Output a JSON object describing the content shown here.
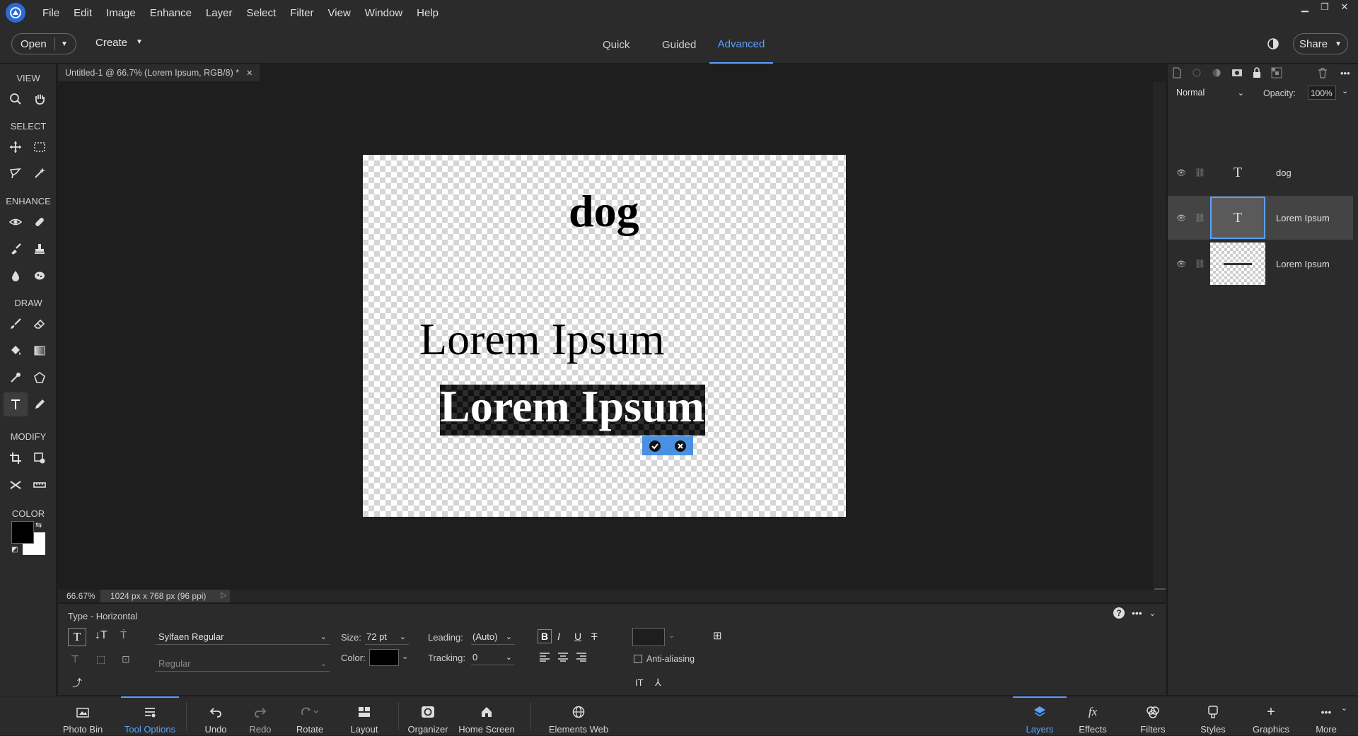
{
  "menubar": {
    "items": [
      "File",
      "Edit",
      "Image",
      "Enhance",
      "Layer",
      "Select",
      "Filter",
      "View",
      "Window",
      "Help"
    ]
  },
  "topbar": {
    "open_label": "Open",
    "create_label": "Create",
    "modes": [
      "Quick",
      "Guided",
      "Advanced"
    ],
    "active_mode": "Advanced",
    "share_label": "Share"
  },
  "toolbar": {
    "sections": [
      "VIEW",
      "SELECT",
      "ENHANCE",
      "DRAW",
      "MODIFY",
      "COLOR"
    ]
  },
  "document": {
    "tab_title": "Untitled-1 @ 66.7% (Lorem Ipsum, RGB/8) *",
    "zoom": "66.67%",
    "dimensions": "1024 px x 768 px (96 ppi)"
  },
  "canvas": {
    "text_dog": "dog",
    "text_lorem1": "Lorem Ipsum",
    "text_lorem2": "Lorem Ipsum"
  },
  "tool_options": {
    "title": "Type - Horizontal",
    "font_family": "Sylfaen Regular",
    "font_style": "Regular",
    "size_label": "Size:",
    "size_value": "72 pt",
    "leading_label": "Leading:",
    "leading_value": "(Auto)",
    "color_label": "Color:",
    "tracking_label": "Tracking:",
    "tracking_value": "0",
    "anti_aliasing_label": "Anti-aliasing",
    "text_color": "#000000"
  },
  "bottombar": {
    "left": [
      "Photo Bin",
      "Tool Options",
      "Undo",
      "Redo",
      "Rotate",
      "Layout",
      "Organizer",
      "Home Screen",
      "Elements Web"
    ],
    "right": [
      "Layers",
      "Effects",
      "Filters",
      "Styles",
      "Graphics",
      "More"
    ],
    "active_left": "Tool Options",
    "active_right": "Layers"
  },
  "layers_panel": {
    "blend_mode": "Normal",
    "opacity_label": "Opacity:",
    "opacity_value": "100%",
    "layers": [
      {
        "name": "dog"
      },
      {
        "name": "Lorem Ipsum"
      },
      {
        "name": "Lorem Ipsum"
      }
    ]
  },
  "colors": {
    "accent": "#5aa0ff",
    "foreground": "#000000",
    "background": "#ffffff",
    "commit_bar": "#4a90e2"
  }
}
